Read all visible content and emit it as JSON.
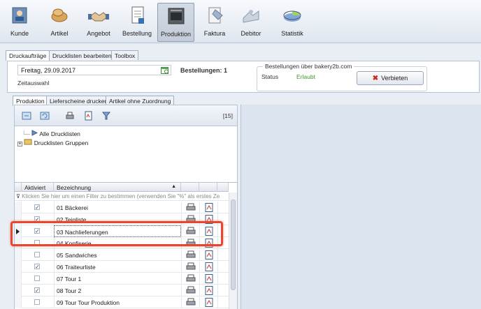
{
  "ribbon": [
    {
      "id": "kunde",
      "label": "Kunde",
      "icon": "customer-icon"
    },
    {
      "id": "artikel",
      "label": "Artikel",
      "icon": "bread-icon"
    },
    {
      "id": "angebot",
      "label": "Angebot",
      "icon": "handshake-icon"
    },
    {
      "id": "bestellung",
      "label": "Bestellung",
      "icon": "order-document-icon"
    },
    {
      "id": "produktion",
      "label": "Produktion",
      "icon": "oven-icon",
      "active": true
    },
    {
      "id": "faktura",
      "label": "Faktura",
      "icon": "invoice-icon"
    },
    {
      "id": "debitor",
      "label": "Debitor",
      "icon": "debtor-icon"
    },
    {
      "id": "statistik",
      "label": "Statistik",
      "icon": "pie-chart-icon"
    }
  ],
  "main_tabs": [
    "Druckaufträge",
    "Drucklisten bearbeiten",
    "Toolbox"
  ],
  "top": {
    "date_value": "Freitag, 29.09.2017",
    "zeitauswahl_label": "Zeitauswahl",
    "bestellungen_label": "Bestellungen: 1",
    "group_title": "Bestellungen über bakery2b.com",
    "status_label": "Status",
    "status_value": "Erlaubt",
    "verbieten_label": "Verbieten"
  },
  "sub_tabs": [
    "Produktion",
    "Lieferscheine drucken",
    "Artikel ohne Zuordnung"
  ],
  "toolbar": {
    "count": "[15]"
  },
  "tree": {
    "item1": "Alle Drucklisten",
    "item2": "Drucklisten Gruppen"
  },
  "grid": {
    "col_aktiviert": "Aktiviert",
    "col_bezeichnung": "Bezeichnung",
    "filter_hint": "Klicken Sie hier um einen Filter zu bestimmen (verwenden Sie \"%\" als erstes Ze",
    "rows": [
      {
        "checked": true,
        "name": "01 Bäckerei"
      },
      {
        "checked": true,
        "name": "02 Teigliste"
      },
      {
        "checked": true,
        "name": "03 Nachlieferungen",
        "selected": true
      },
      {
        "checked": false,
        "name": "04 Konfiserie"
      },
      {
        "checked": false,
        "name": "05 Sandwiches"
      },
      {
        "checked": true,
        "name": "06 Traiteurliste"
      },
      {
        "checked": false,
        "name": "07 Tour 1"
      },
      {
        "checked": true,
        "name": "08 Tour 2"
      },
      {
        "checked": false,
        "name": "09 Tour Tour Produktion"
      }
    ]
  },
  "colors": {
    "status_green": "#3d9a2b",
    "highlight_red": "#e8462e",
    "accent_blue": "#2a4c86"
  }
}
